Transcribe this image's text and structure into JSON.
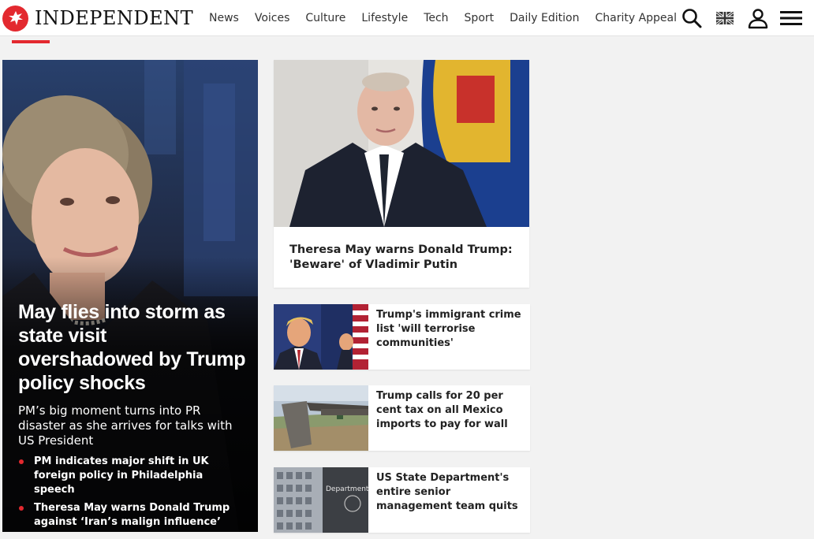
{
  "header": {
    "brand": "INDEPENDENT",
    "nav": [
      "News",
      "Voices",
      "Culture",
      "Lifestyle",
      "Tech",
      "Sport",
      "Daily Edition",
      "Charity Appeal"
    ],
    "icons": [
      "search-icon",
      "uk-flag-icon",
      "account-icon",
      "menu-icon"
    ]
  },
  "hero": {
    "title": "May flies into storm as state visit overshadowed by Trump policy shocks",
    "standfirst": "PM’s big moment turns into PR disaster as she arrives for talks with US President",
    "bullets": [
      "PM indicates major shift in UK foreign policy in Philadelphia speech",
      "Theresa May warns Donald Trump against ‘Iran’s malign influence’"
    ]
  },
  "feature": {
    "headline": "Theresa May warns Donald Trump: 'Beware' of Vladimir Putin"
  },
  "stories": [
    {
      "headline": "Trump's immigrant crime list 'will terrorise communities'"
    },
    {
      "headline": "Trump calls for 20 per cent tax on all Mexico imports to pay for wall"
    },
    {
      "headline": "US State Department's entire senior management team quits",
      "sign_text": "Department Of State"
    }
  ],
  "colors": {
    "brand_red": "#e3292f",
    "text": "#222222",
    "background": "#f2f2f2"
  }
}
